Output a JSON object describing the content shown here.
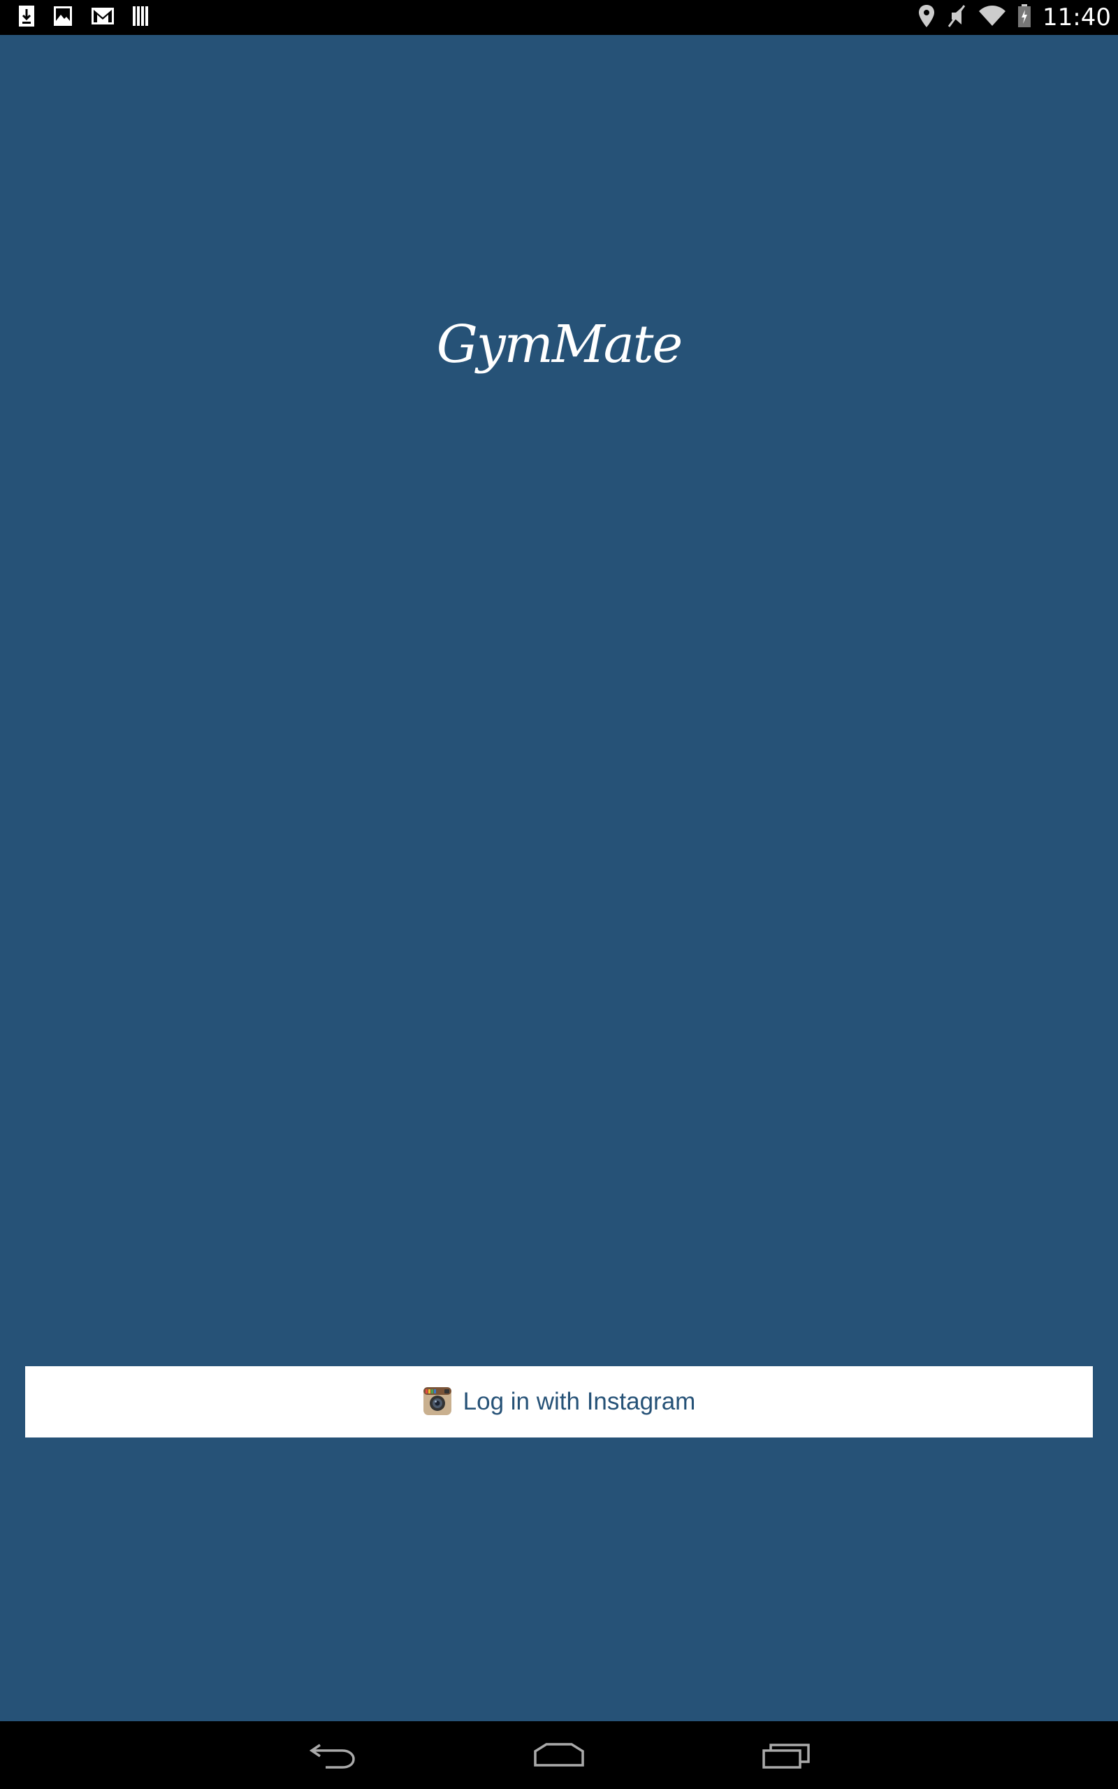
{
  "status_bar": {
    "time": "11:40",
    "left_icons": [
      "download-icon",
      "image-icon",
      "gmail-icon",
      "barcode-icon"
    ],
    "right_icons": [
      "location-icon",
      "mute-icon",
      "wifi-icon",
      "battery-icon"
    ]
  },
  "app": {
    "logo_text": "GymMate",
    "background_color": "#265277"
  },
  "login": {
    "label": "Log in with Instagram",
    "icon": "instagram-icon"
  },
  "nav_bar": {
    "buttons": [
      "back-icon",
      "home-icon",
      "recent-apps-icon"
    ]
  }
}
